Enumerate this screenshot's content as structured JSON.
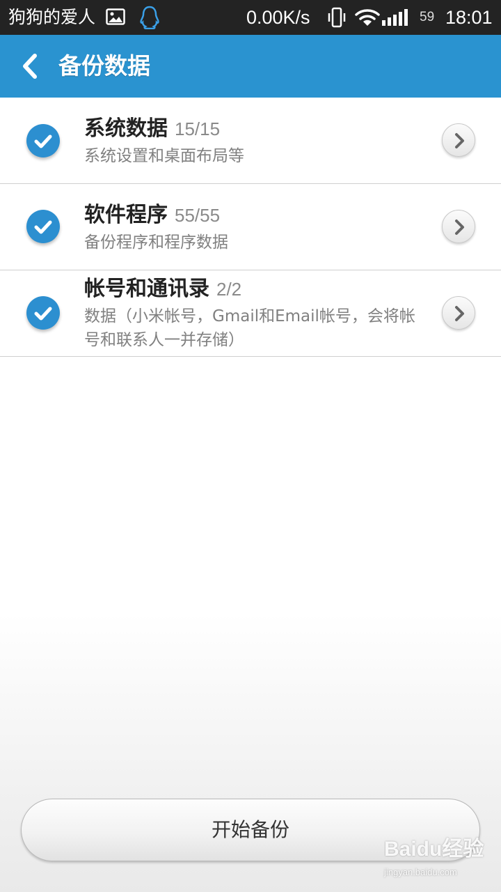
{
  "status_bar": {
    "carrier": "狗狗的爱人",
    "net_speed": "0.00K/s",
    "battery": "59",
    "time": "18:01",
    "icons": [
      "photo-icon",
      "qq-penguin-icon",
      "vibrate-icon",
      "wifi-icon",
      "signal-icon"
    ]
  },
  "header": {
    "title": "备份数据",
    "back_icon": "chevron-left-icon",
    "color": "#2a93d0"
  },
  "items": [
    {
      "title": "系统数据",
      "count": "15/15",
      "desc": "系统设置和桌面布局等",
      "checked": true
    },
    {
      "title": "软件程序",
      "count": "55/55",
      "desc": "备份程序和程序数据",
      "checked": true
    },
    {
      "title": "帐号和通讯录",
      "count": "2/2",
      "desc": "数据（小米帐号，Gmail和Email帐号，会将帐号和联系人一并存储）",
      "checked": true
    }
  ],
  "footer": {
    "start_button_label": "开始备份"
  },
  "watermark": {
    "brand": "Baidu经验",
    "url": "jingyan.baidu.com"
  },
  "colors": {
    "accent": "#2a93d0",
    "check": "#2c8fd0",
    "status_bar": "#232323"
  }
}
